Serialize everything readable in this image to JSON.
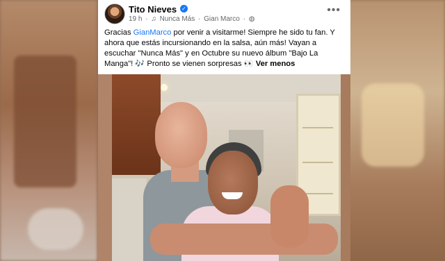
{
  "post": {
    "author": "Tito Nieves",
    "verified_icon": "verified-badge-icon",
    "meta": {
      "time": "19 h",
      "separator": "·",
      "music_icon": "music-note-icon",
      "song": "Nunca Más",
      "separator2": "·",
      "artist": "Gian Marco",
      "separator3": "·",
      "privacy_icon": "globe-icon"
    },
    "more_label": "•••",
    "text": {
      "part1": "Gracias ",
      "mention": "GianMarco",
      "part2": " por venir a visitarme! Siempre he sido tu fan. Y ahora que estás incursionando en la salsa, aún más! Vayan a escuchar \"Nunca Más\" y en Octubre su nuevo álbum \"Bajo La Manga\"! 🎶 Pronto se vienen sorpresas 👀 ",
      "see_less": "Ver menos"
    }
  }
}
